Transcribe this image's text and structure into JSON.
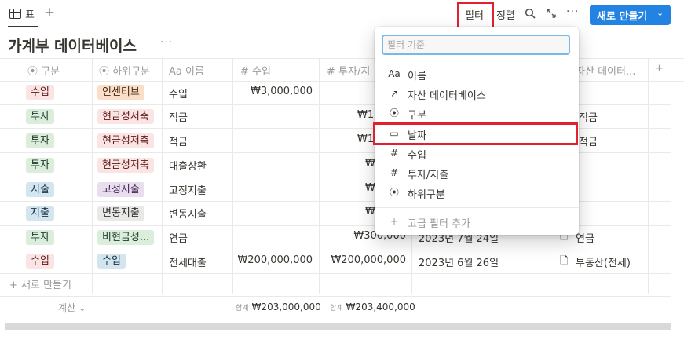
{
  "topbar": {
    "view_tab_label": "표",
    "add_view": "+",
    "filter_label": "필터",
    "sort_label": "정렬",
    "more": "···",
    "new_button_label": "새로 만들기",
    "new_button_chevron": "⌄"
  },
  "page": {
    "title": "가계부 데이터베이스",
    "title_more": "···"
  },
  "columns": [
    {
      "icon": "⦿",
      "label": "구분"
    },
    {
      "icon": "⦿",
      "label": "하위구분"
    },
    {
      "icon": "Aa",
      "label": "이름"
    },
    {
      "icon": "#",
      "label": "수입"
    },
    {
      "icon": "#",
      "label": "투자/지"
    },
    {
      "icon": "",
      "label": ""
    },
    {
      "icon": "↗",
      "label": "자산 데이터..."
    }
  ],
  "add_column": "+",
  "rows": [
    {
      "type": "수입",
      "type_color": "red",
      "sub": "인센티브",
      "sub_color": "orange",
      "name": "수입",
      "income": "₩3,000,000",
      "invest": "",
      "date": "",
      "asset": ""
    },
    {
      "type": "투자",
      "type_color": "green",
      "sub": "현금성저축",
      "sub_color": "red",
      "name": "적금",
      "income": "",
      "invest": "₩1,(",
      "date": "",
      "asset": "적금"
    },
    {
      "type": "투자",
      "type_color": "green",
      "sub": "현금성저축",
      "sub_color": "red",
      "name": "적금",
      "income": "",
      "invest": "₩1,",
      "date": "",
      "asset": "적금"
    },
    {
      "type": "투자",
      "type_color": "green",
      "sub": "현금성저축",
      "sub_color": "red",
      "name": "대출상환",
      "income": "",
      "invest": "₩(",
      "date": "",
      "asset": ""
    },
    {
      "type": "지출",
      "type_color": "blue",
      "sub": "고정지출",
      "sub_color": "purple",
      "name": "고정지출",
      "income": "",
      "invest": "₩",
      "date": "",
      "asset": ""
    },
    {
      "type": "지출",
      "type_color": "blue",
      "sub": "변동지출",
      "sub_color": "gray",
      "name": "변동지출",
      "income": "",
      "invest": "₩",
      "date": "",
      "asset": ""
    },
    {
      "type": "투자",
      "type_color": "green",
      "sub": "비현금성...",
      "sub_color": "green",
      "name": "연금",
      "income": "",
      "invest": "₩300,000",
      "date": "2023년 7월 24일",
      "asset": "연금"
    },
    {
      "type": "수입",
      "type_color": "red",
      "sub": "수입",
      "sub_color": "blue",
      "name": "전세대출",
      "income": "₩200,000,000",
      "invest": "₩200,000,000",
      "date": "2023년 6월 26일",
      "asset": "부동산(전세)"
    }
  ],
  "new_row_label": "+ 새로 만들기",
  "calc_label": "계산 ⌄",
  "sum_label": "합계",
  "sum_income": "₩203,000,000",
  "sum_invest": "₩203,400,000",
  "filter_dropdown": {
    "search_placeholder": "필터 기준",
    "items": [
      {
        "icon": "Aa",
        "label": "이름"
      },
      {
        "icon": "↗",
        "label": "자산 데이터베이스"
      },
      {
        "icon": "⦿",
        "label": "구분"
      },
      {
        "icon": "▭",
        "label": "날짜"
      },
      {
        "icon": "#",
        "label": "수입"
      },
      {
        "icon": "#",
        "label": "투자/지출"
      },
      {
        "icon": "⦿",
        "label": "하위구분"
      }
    ],
    "advanced_icon": "+",
    "advanced_label": "고급 필터 추가"
  },
  "colors": {
    "accent": "#2383e2",
    "highlight": "#e3202e"
  }
}
